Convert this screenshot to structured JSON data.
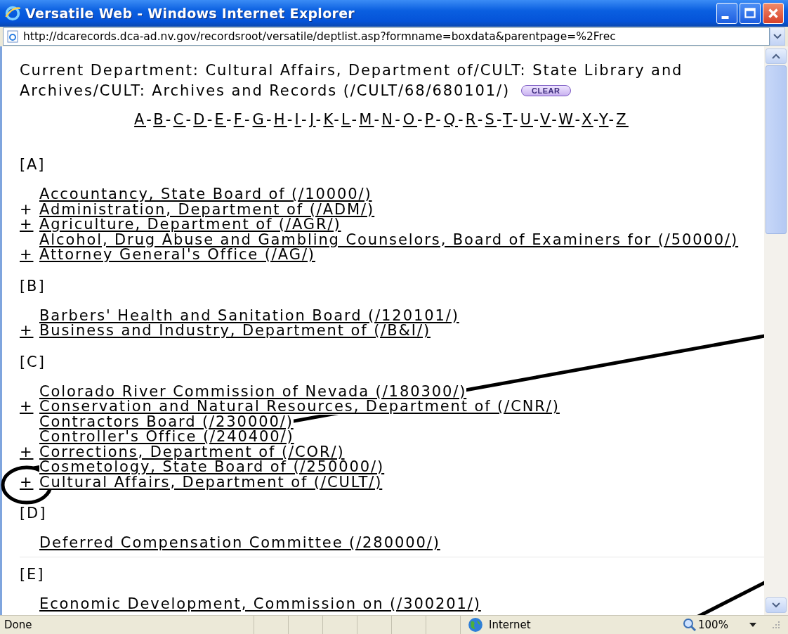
{
  "window": {
    "title": "Versatile Web - Windows Internet Explorer"
  },
  "address_bar": {
    "value": "http://dcarecords.dca-ad.nv.gov/recordsroot/versatile/deptlist.asp?formname=boxdata&parentpage=%2Frec"
  },
  "current_department": {
    "lines": [
      "Current Department: Cultural Affairs, Department of/CULT: State Library and",
      "Archives/CULT: Archives and Records (/CULT/68/680101/)"
    ],
    "button": "CLEAR"
  },
  "alphabet": [
    "A",
    "B",
    "C",
    "D",
    "E",
    "F",
    "G",
    "H",
    "I",
    "J",
    "K",
    "L",
    "M",
    "N",
    "O",
    "P",
    "Q",
    "R",
    "S",
    "T",
    "U",
    "V",
    "W",
    "X",
    "Y",
    "Z"
  ],
  "separator": "-",
  "sections": [
    {
      "heading": "[A]",
      "items": [
        {
          "label": "Accountancy, State Board of (/10000/)"
        },
        {
          "toggle": "+",
          "label": "Administration, Department of (/ADM/)"
        },
        {
          "toggle": "+",
          "label": "Agriculture, Department of (/AGR/)"
        },
        {
          "label": "Alcohol, Drug Abuse and Gambling Counselors, Board of Examiners for (/50000/)"
        },
        {
          "toggle": "+",
          "label": "Attorney General's Office (/AG/)"
        }
      ]
    },
    {
      "heading": "[B]",
      "items": [
        {
          "label": "Barbers' Health and Sanitation Board (/120101/)"
        },
        {
          "toggle": "+",
          "label": "Business and Industry, Department of (/B&I/)"
        }
      ]
    },
    {
      "heading": "[C]",
      "items": [
        {
          "label": "Colorado River Commission of Nevada (/180300/)"
        },
        {
          "toggle": "+",
          "label": "Conservation and Natural Resources, Department of (/CNR/)"
        },
        {
          "label": "Contractors Board (/230000/)"
        },
        {
          "label": "Controller's Office (/240400/)"
        },
        {
          "toggle": "+",
          "label": "Corrections, Department of (/COR/)"
        },
        {
          "label": "Cosmetology, State Board of (/250000/)"
        },
        {
          "toggle": "+",
          "label": "Cultural Affairs, Department of (/CULT/)"
        }
      ]
    },
    {
      "heading": "[D]",
      "divider": true,
      "items": [
        {
          "label": "Deferred Compensation Committee (/280000/)"
        }
      ]
    },
    {
      "heading": "[E]",
      "items": [
        {
          "label": "Economic Development, Commission on (/300201/)"
        }
      ]
    }
  ],
  "status_bar": {
    "status": "Done",
    "zone": "Internet",
    "zoom": "100%"
  }
}
